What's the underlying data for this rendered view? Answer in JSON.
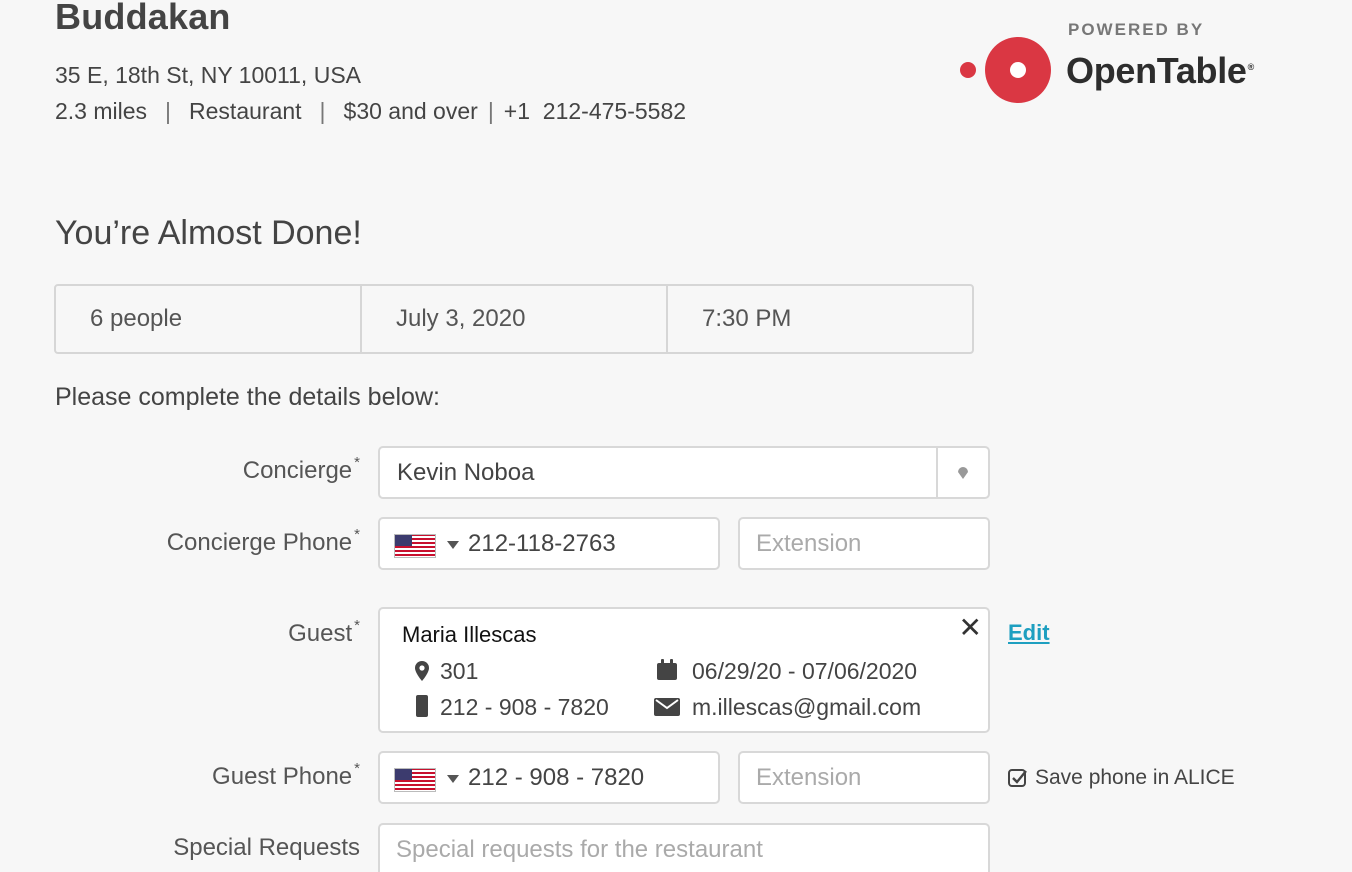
{
  "restaurant": {
    "name": "Buddakan",
    "address": "35 E, 18th St, NY 10011, USA",
    "distance": "2.3 miles",
    "type": "Restaurant",
    "price": "$30 and over",
    "phone": "+1  212-475-5582"
  },
  "branding": {
    "powered_by": "POWERED BY",
    "logo_text": "OpenTable",
    "logo_reg": "®",
    "accent_color": "#da3743"
  },
  "page": {
    "heading": "You’re Almost Done!",
    "instructions": "Please complete the details below:"
  },
  "reservation": {
    "party": "6 people",
    "date": "July 3, 2020",
    "time": "7:30 PM"
  },
  "form": {
    "concierge_label": "Concierge",
    "concierge_value": "Kevin Noboa",
    "concierge_phone_label": "Concierge Phone",
    "concierge_phone_value": "212-118-2763",
    "extension_placeholder": "Extension",
    "guest_label": "Guest",
    "guest_phone_label": "Guest Phone",
    "guest_phone_value": "212 - 908 - 7820",
    "special_requests_label": "Special Requests",
    "special_requests_placeholder": "Special requests for the restaurant",
    "required_mark": "*",
    "save_phone_label": "Save phone in ALICE",
    "edit_label": "Edit"
  },
  "guest": {
    "name": "Maria Illescas",
    "room": "301",
    "dates": "06/29/20 - 07/06/2020",
    "phone": "212 - 908 - 7820",
    "email": "m.illescas@gmail.com",
    "close_glyph": "✕"
  }
}
